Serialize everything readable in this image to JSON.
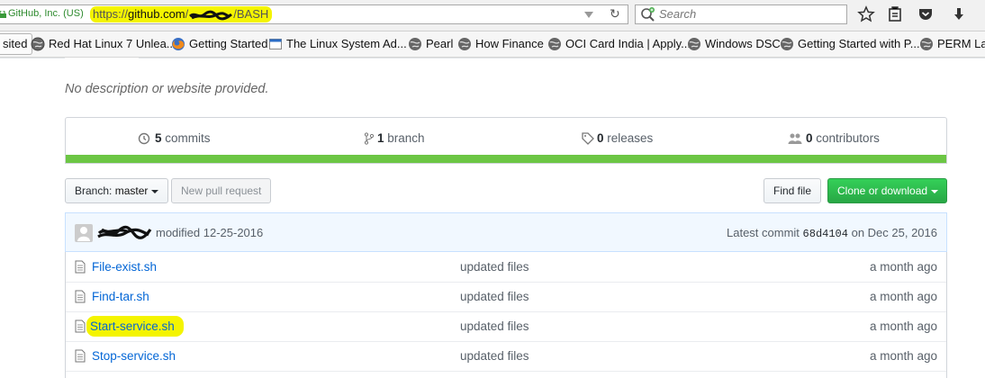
{
  "browser": {
    "identity": "GitHub, Inc. (US)",
    "url_proto": "https://",
    "url_host": "github.com",
    "url_slash": "/",
    "url_path": "/BASH",
    "search_placeholder": "Search",
    "toolbar_icons": [
      "star-icon",
      "reading-list-icon",
      "pocket-icon",
      "download-icon"
    ]
  },
  "bookmarks": {
    "first": "sited",
    "items": [
      {
        "label": "Red Hat Linux 7 Unlea...",
        "icon": "globe-icon"
      },
      {
        "label": "Getting Started",
        "icon": "firefox-icon"
      },
      {
        "label": "The Linux System Ad...",
        "icon": "page-icon"
      },
      {
        "label": "Pearl",
        "icon": "globe-icon"
      },
      {
        "label": "How Finance",
        "icon": "globe-icon"
      },
      {
        "label": "OCI Card India | Apply...",
        "icon": "globe-icon"
      },
      {
        "label": "Windows DSC",
        "icon": "globe-icon"
      },
      {
        "label": "Getting Started with P...",
        "icon": "globe-icon"
      },
      {
        "label": "PERM Lab",
        "icon": "globe-icon"
      }
    ]
  },
  "repo": {
    "description": "No description or website provided.",
    "stats": {
      "commits_count": "5",
      "commits_label": "commits",
      "branch_count": "1",
      "branch_label": "branch",
      "releases_count": "0",
      "releases_label": "releases",
      "contributors_count": "0",
      "contributors_label": "contributors"
    },
    "language_color": "#6cc644",
    "branch_prefix": "Branch:",
    "branch_name": "master",
    "new_pull_request": "New pull request",
    "find_file": "Find file",
    "clone_download": "Clone or download",
    "latest_commit": {
      "message": "modified 12-25-2016",
      "label": "Latest commit",
      "sha": "68d4104",
      "date": "on Dec 25, 2016"
    },
    "files": [
      {
        "name": "File-exist.sh",
        "message": "updated files",
        "age": "a month ago"
      },
      {
        "name": "Find-tar.sh",
        "message": "updated files",
        "age": "a month ago"
      },
      {
        "name": "Start-service.sh",
        "message": "updated files",
        "age": "a month ago"
      },
      {
        "name": "Stop-service.sh",
        "message": "updated files",
        "age": "a month ago"
      }
    ]
  },
  "colors": {
    "highlight": "#f4f400",
    "link": "#0366d6",
    "green_button": "#28a745",
    "identity_green": "#2d8a2d"
  }
}
